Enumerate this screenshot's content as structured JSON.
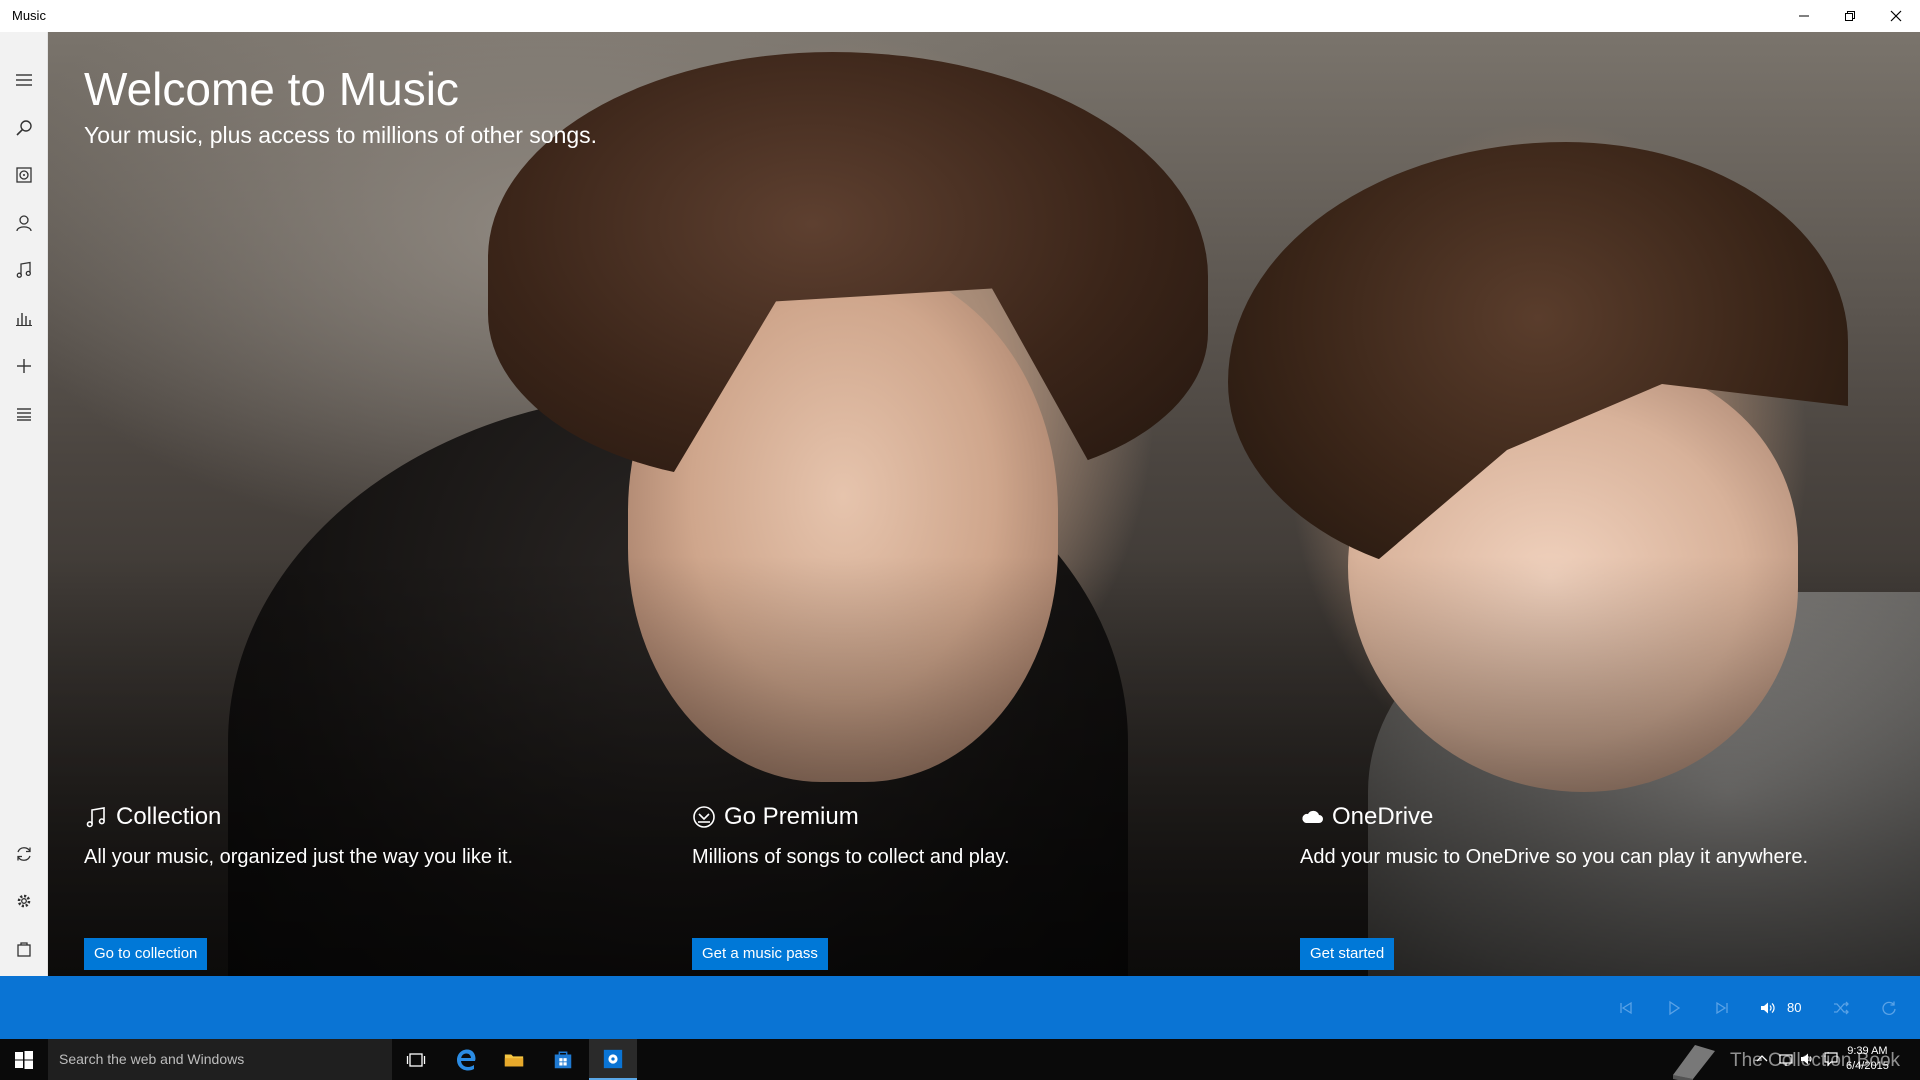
{
  "window": {
    "title": "Music"
  },
  "hero": {
    "title": "Welcome to Music",
    "subtitle": "Your music, plus access to millions of other songs."
  },
  "features": [
    {
      "icon": "music-note-icon",
      "title": "Collection",
      "description": "All your music, organized just the way you like it.",
      "button": "Go to collection"
    },
    {
      "icon": "premium-icon",
      "title": "Go Premium",
      "description": "Millions of songs to collect and play.",
      "button": "Get a music pass"
    },
    {
      "icon": "cloud-icon",
      "title": "OneDrive",
      "description": "Add your music to OneDrive so you can play it anywhere.",
      "button": "Get started"
    }
  ],
  "player": {
    "volume": "80"
  },
  "taskbar": {
    "search_placeholder": "Search the web and Windows",
    "time": "9:39 AM",
    "date": "6/4/2015",
    "watermark": "The Collection Book"
  },
  "colors": {
    "accent": "#0078d7",
    "player_bar": "#0a74d4",
    "taskbar": "#0a0a0a"
  }
}
